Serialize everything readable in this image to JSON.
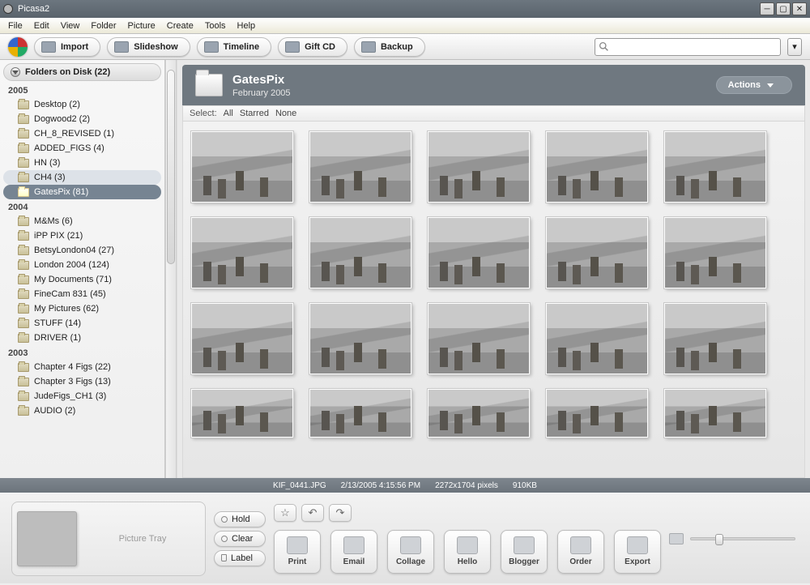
{
  "window": {
    "title": "Picasa2"
  },
  "menu": [
    "File",
    "Edit",
    "View",
    "Folder",
    "Picture",
    "Create",
    "Tools",
    "Help"
  ],
  "toolbar": {
    "import": "Import",
    "slideshow": "Slideshow",
    "timeline": "Timeline",
    "giftcd": "Gift CD",
    "backup": "Backup",
    "search_placeholder": ""
  },
  "sidebar": {
    "header": "Folders on Disk (22)",
    "groups": [
      {
        "year": "2005",
        "items": [
          {
            "label": "Desktop (2)"
          },
          {
            "label": "Dogwood2 (2)"
          },
          {
            "label": "CH_8_REVISED (1)"
          },
          {
            "label": "ADDED_FIGS (4)"
          },
          {
            "label": "HN (3)"
          },
          {
            "label": "CH4 (3)",
            "hilite": true
          },
          {
            "label": "GatesPix (81)",
            "sel": true
          }
        ]
      },
      {
        "year": "2004",
        "items": [
          {
            "label": "M&Ms (6)"
          },
          {
            "label": "iPP PIX (21)"
          },
          {
            "label": "BetsyLondon04 (27)"
          },
          {
            "label": "London 2004 (124)"
          },
          {
            "label": "My Documents (71)"
          },
          {
            "label": "FineCam 831 (45)"
          },
          {
            "label": "My Pictures (62)"
          },
          {
            "label": "STUFF (14)"
          },
          {
            "label": "DRIVER (1)"
          }
        ]
      },
      {
        "year": "2003",
        "items": [
          {
            "label": "Chapter 4 Figs (22)"
          },
          {
            "label": "Chapter 3 Figs (13)"
          },
          {
            "label": "JudeFigs_CH1 (3)"
          },
          {
            "label": "AUDIO (2)"
          }
        ]
      }
    ]
  },
  "folder": {
    "name": "GatesPix",
    "date": "February 2005",
    "actions": "Actions"
  },
  "select": {
    "label": "Select:",
    "all": "All",
    "starred": "Starred",
    "none": "None"
  },
  "status": {
    "filename": "KIF_0441.JPG",
    "datetime": "2/13/2005 4:15:56 PM",
    "dims": "2272x1704 pixels",
    "size": "910KB"
  },
  "tray": {
    "label": "Picture Tray"
  },
  "pills": {
    "hold": "Hold",
    "clear": "Clear",
    "label": "Label"
  },
  "actions": [
    "Print",
    "Email",
    "Collage",
    "Hello",
    "Blogger",
    "Order",
    "Export"
  ]
}
